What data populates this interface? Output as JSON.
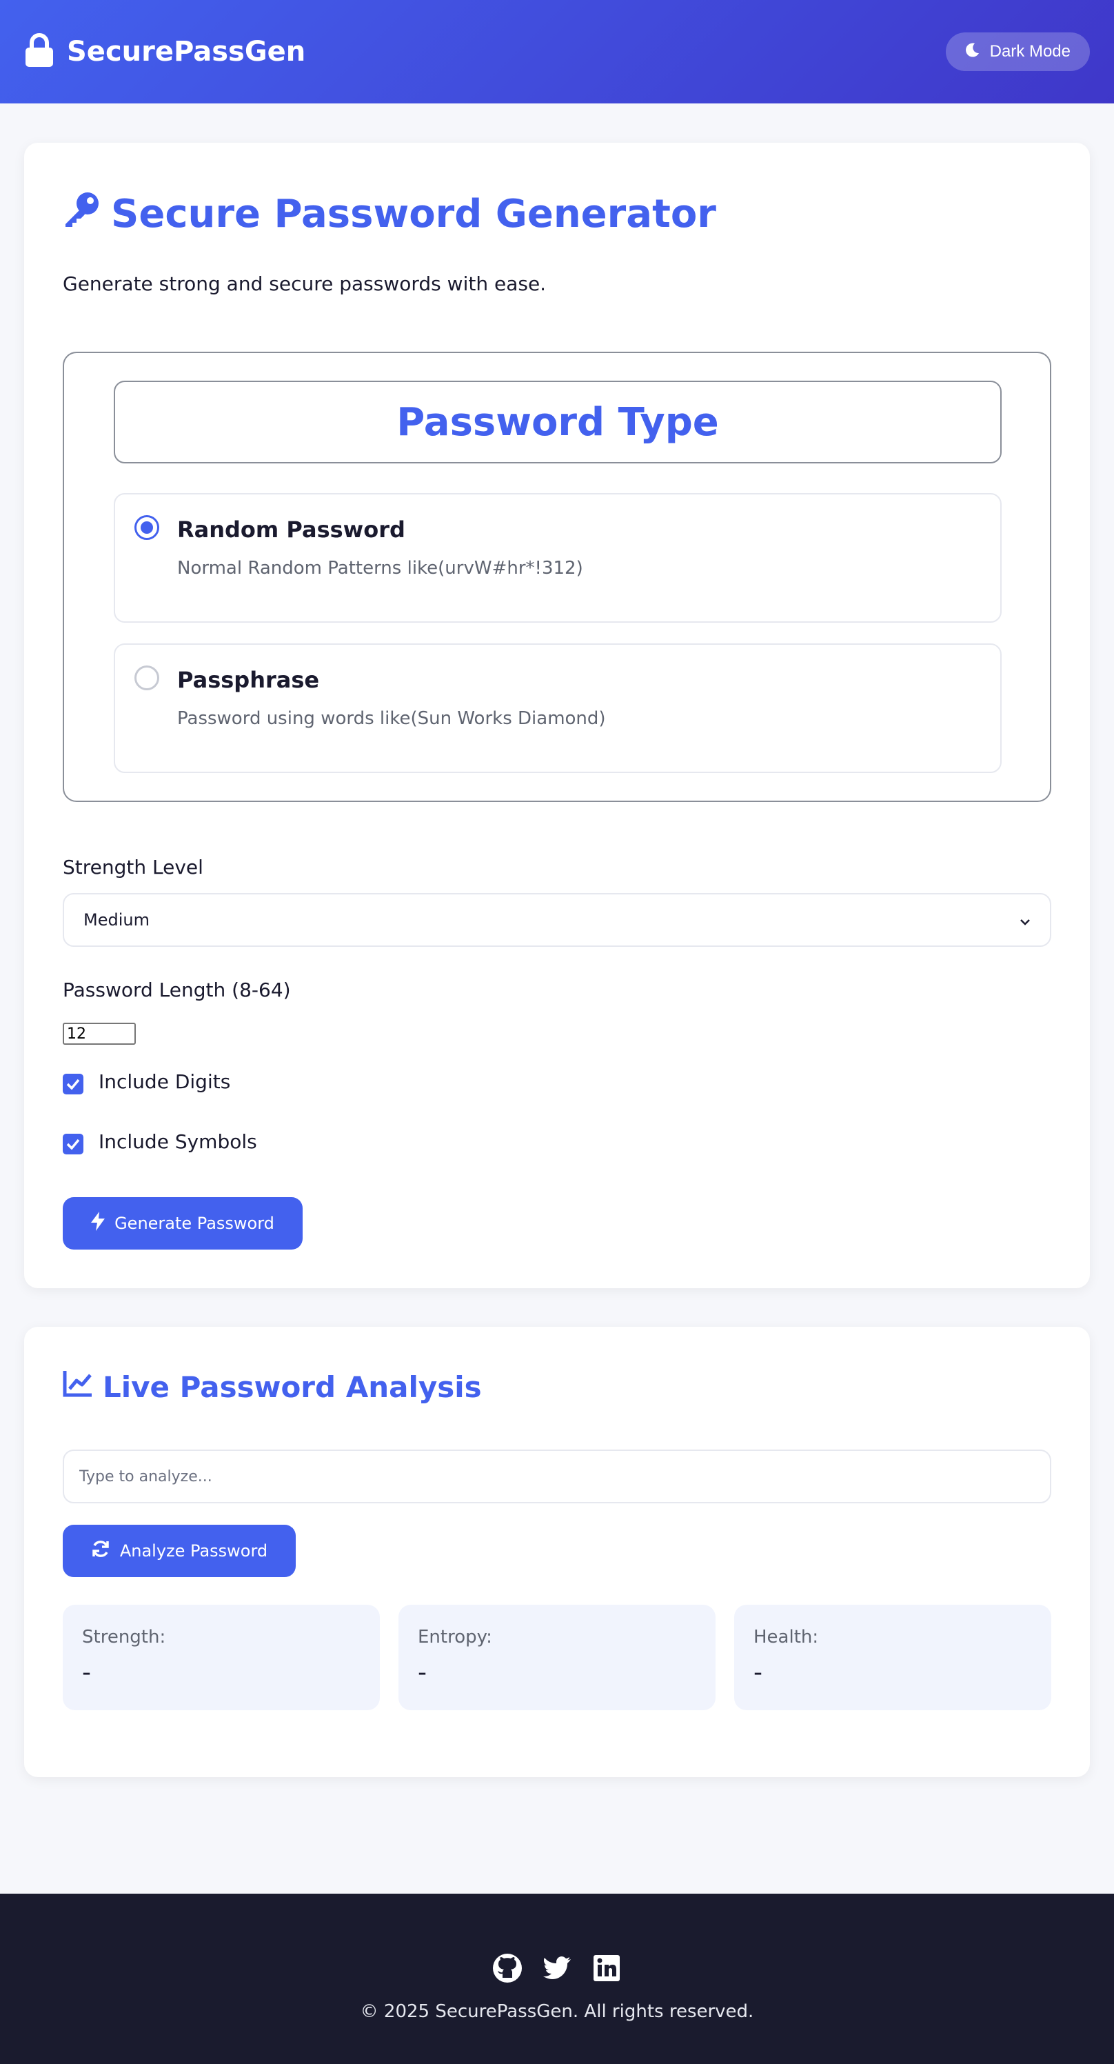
{
  "app": {
    "brand": "SecurePassGen",
    "brand_icon": "lock-icon",
    "theme_toggle_label": "Dark Mode",
    "theme_toggle_icon": "moon-icon"
  },
  "colors": {
    "primary": "#4361ee",
    "header_gradient_end": "#3f37c9",
    "footer_bg": "#1a1b2e",
    "metric_bg": "#f1f4fd"
  },
  "generator": {
    "title": "Secure Password Generator",
    "title_icon": "key-icon",
    "subtitle": "Generate strong and secure passwords with ease.",
    "password_type": {
      "legend": "Password Type",
      "options": [
        {
          "title": "Random Password",
          "description": "Normal Random Patterns like(urvW#hr*!312)",
          "selected": true
        },
        {
          "title": "Passphrase",
          "description": "Password using words like(Sun Works Diamond)",
          "selected": false
        }
      ]
    },
    "strength": {
      "label": "Strength Level",
      "selected": "Medium"
    },
    "length": {
      "label": "Password Length (8-64)",
      "value": "12"
    },
    "include_digits": {
      "label": "Include Digits",
      "checked": true
    },
    "include_symbols": {
      "label": "Include Symbols",
      "checked": true
    },
    "generate_button": {
      "label": "Generate Password",
      "icon": "bolt-icon"
    }
  },
  "analysis": {
    "title": "Live Password Analysis",
    "title_icon": "chart-line-icon",
    "input_placeholder": "Type to analyze...",
    "analyze_button": {
      "label": "Analyze Password",
      "icon": "sync-icon"
    },
    "metrics": [
      {
        "label": "Strength:",
        "value": "-"
      },
      {
        "label": "Entropy:",
        "value": "-"
      },
      {
        "label": "Health:",
        "value": "-"
      }
    ]
  },
  "footer": {
    "social_icons": [
      "github-icon",
      "twitter-icon",
      "linkedin-icon"
    ],
    "copyright": "© 2025 SecurePassGen. All rights reserved."
  }
}
